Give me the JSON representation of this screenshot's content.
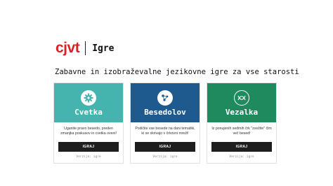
{
  "header": {
    "logo": "cjvt",
    "section": "Igre"
  },
  "tagline": "Zabavne in izobraževalne jezikovne igre za vse starosti",
  "cards": [
    {
      "title": "Cvetka",
      "description": "Uganite pravo besedo, preden zmanjka poskusov in cvetka oveni!",
      "button": "IGRAJ",
      "version": "Verzija: igre",
      "color": "#45b3ae",
      "icon": "flower-gear-icon"
    },
    {
      "title": "Besedolov",
      "description": "Poiščite vse besede na dani tematiki, ki se skrivajo v črkovni mreži!",
      "button": "IGRAJ",
      "version": "Verzija: igre",
      "color": "#1e5a8e",
      "icon": "network-icon"
    },
    {
      "title": "Vezalka",
      "description": "Iz ponujenih sedmih črk \"zvežite\" čim več besed!",
      "button": "IGRAJ",
      "version": "Verzija: igre",
      "color": "#1f8a5e",
      "icon": "knot-icon"
    }
  ]
}
